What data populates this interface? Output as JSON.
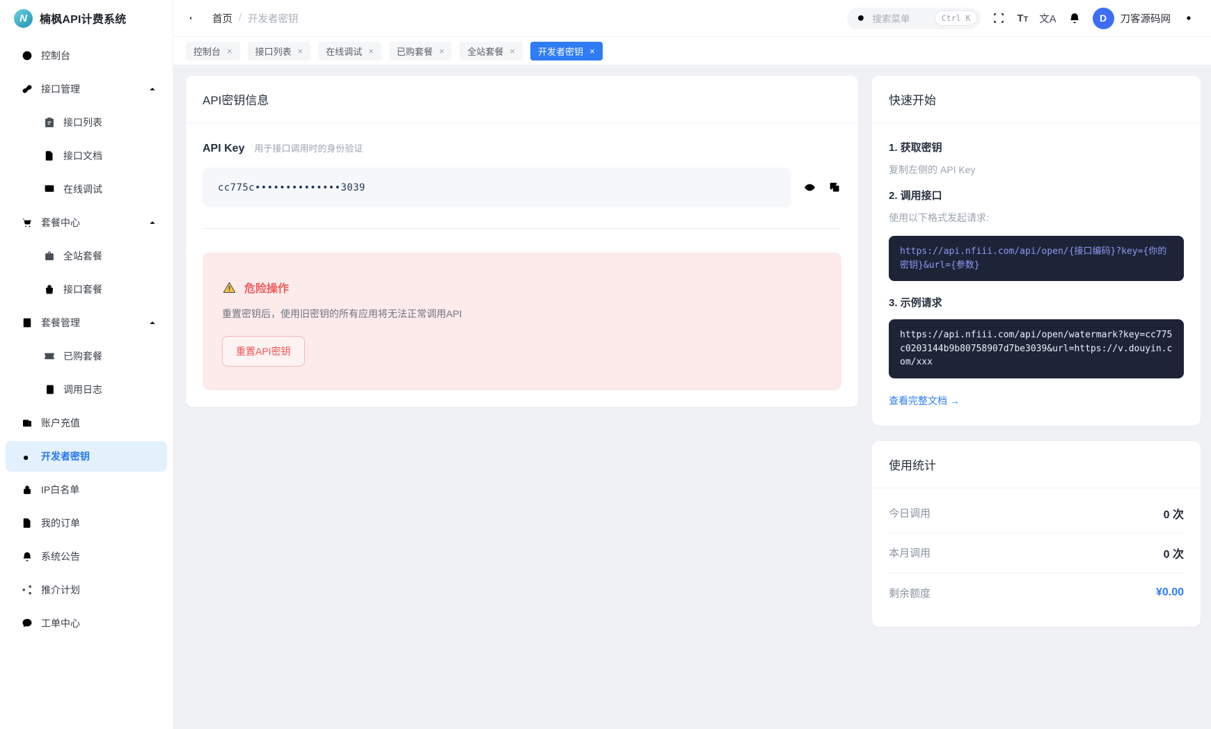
{
  "app": {
    "name": "楠枫API计费系统",
    "logo_letter": "N"
  },
  "ui": {
    "close_glyph": "×",
    "font_size_glyph_big": "T",
    "font_size_glyph_small": "T",
    "translate_glyph": "文A"
  },
  "header": {
    "breadcrumb_home": "首页",
    "breadcrumb_sep": "/",
    "breadcrumb_current": "开发者密钥",
    "search_placeholder": "搜索菜单",
    "search_shortcut": "Ctrl K",
    "username": "刀客源码网",
    "avatar_letter": "D"
  },
  "tabs": [
    {
      "label": "控制台",
      "active": false
    },
    {
      "label": "接口列表",
      "active": false
    },
    {
      "label": "在线调试",
      "active": false
    },
    {
      "label": "已购套餐",
      "active": false
    },
    {
      "label": "全站套餐",
      "active": false
    },
    {
      "label": "开发者密钥",
      "active": true
    }
  ],
  "sidebar": {
    "items": [
      {
        "label": "控制台",
        "icon": "gauge"
      },
      {
        "label": "接口管理",
        "icon": "api-link",
        "group": true
      },
      {
        "label": "接口列表",
        "icon": "clipboard",
        "child": true
      },
      {
        "label": "接口文档",
        "icon": "file-text",
        "child": true
      },
      {
        "label": "在线调试",
        "icon": "monitor",
        "child": true
      },
      {
        "label": "套餐中心",
        "icon": "cart",
        "group": true
      },
      {
        "label": "全站套餐",
        "icon": "briefcase",
        "child": true
      },
      {
        "label": "接口套餐",
        "icon": "bag",
        "child": true
      },
      {
        "label": "套餐管理",
        "icon": "doc-list",
        "group": true
      },
      {
        "label": "已购套餐",
        "icon": "ticket",
        "child": true
      },
      {
        "label": "调用日志",
        "icon": "notebook",
        "child": true
      },
      {
        "label": "账户充值",
        "icon": "wallet"
      },
      {
        "label": "开发者密钥",
        "icon": "key",
        "active": true
      },
      {
        "label": "IP白名单",
        "icon": "lock"
      },
      {
        "label": "我的订单",
        "icon": "doc-check"
      },
      {
        "label": "系统公告",
        "icon": "bell"
      },
      {
        "label": "推介计划",
        "icon": "share"
      },
      {
        "label": "工单中心",
        "icon": "chat"
      }
    ]
  },
  "main": {
    "title": "API密钥信息",
    "key_label": "API Key",
    "key_hint": "用于接口调用时的身份验证",
    "key_value": "cc775c••••••••••••••3039",
    "danger_title": "危险操作",
    "danger_desc": "重置密钥后，使用旧密钥的所有应用将无法正常调用API",
    "danger_button": "重置API密钥"
  },
  "quick_start": {
    "title": "快速开始",
    "step1_title": "1. 获取密钥",
    "step1_desc": "复制左侧的 API Key",
    "step2_title": "2. 调用接口",
    "step2_desc": "使用以下格式发起请求:",
    "code_format": "https://api.nfiii.com/api/open/{接口编码}?key={你的密钥}&url={参数}",
    "step3_title": "3. 示例请求",
    "code_example": "https://api.nfiii.com/api/open/watermark?key=cc775c0203144b9b80758907d7be3039&url=https://v.douyin.com/xxx",
    "doc_link": "查看完整文档 →"
  },
  "usage": {
    "title": "使用统计",
    "rows": [
      {
        "label": "今日调用",
        "value": "0 次"
      },
      {
        "label": "本月调用",
        "value": "0 次"
      },
      {
        "label": "剩余额度",
        "value": "¥0.00"
      }
    ]
  },
  "colors": {
    "primary": "#2e7cf6",
    "sidebar_active_bg": "#e3f1fd",
    "danger_text": "#f15e5e",
    "danger_bg": "#fdeaea",
    "code_bg": "#1d2438",
    "code_text_format": "#8e99f3",
    "code_text_example": "#edf0fa"
  }
}
